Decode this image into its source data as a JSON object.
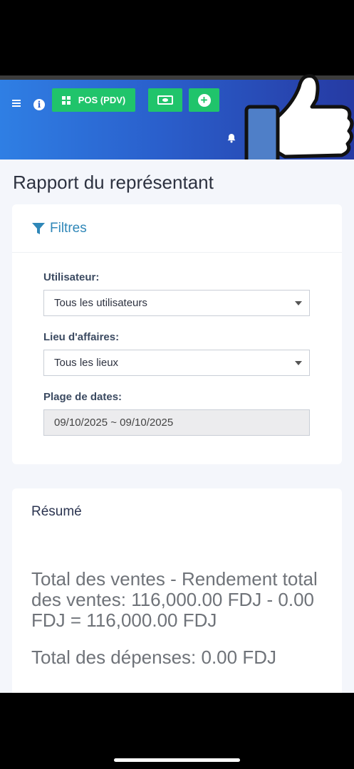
{
  "header": {
    "pos_button_label": "POS (PDV)",
    "icons": [
      "menu-icon",
      "info-icon",
      "grid-icon",
      "money-icon",
      "plus-icon",
      "bell-icon",
      "thumbs-up-sticker"
    ]
  },
  "page": {
    "title": "Rapport du représentant"
  },
  "filters": {
    "title": "Filtres",
    "user_label": "Utilisateur:",
    "user_value": "Tous les utilisateurs",
    "location_label": "Lieu d'affaires:",
    "location_value": "Tous les lieux",
    "date_label": "Plage de dates:",
    "date_value": "09/10/2025 ~ 09/10/2025"
  },
  "summary": {
    "title": "Résumé",
    "sales_line": "Total des ventes - Rendement total des ventes: 116,000.00 FDJ - 0.00 FDJ = 116,000.00 FDJ",
    "expenses_line": "Total des dépenses: 0.00 FDJ"
  },
  "colors": {
    "accent_green": "#20c46b",
    "nav_start": "#2f7fe4",
    "nav_end": "#263aa3",
    "filter_blue": "#2f87b8"
  }
}
